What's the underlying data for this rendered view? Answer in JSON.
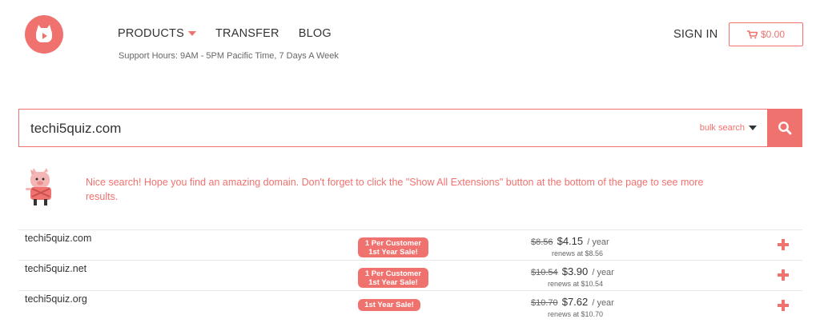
{
  "brand": {
    "logo_icon": "pig-logo-icon",
    "accent": "#f0726f"
  },
  "nav": {
    "products": "PRODUCTS",
    "transfer": "TRANSFER",
    "blog": "BLOG",
    "support": "Support Hours: 9AM - 5PM Pacific Time, 7 Days A Week"
  },
  "header": {
    "signin": "SIGN IN",
    "cart_total": "$0.00",
    "cart_icon": "cart-icon"
  },
  "search": {
    "value": "techi5quiz.com",
    "bulk_label": "bulk search",
    "button_icon": "search-icon"
  },
  "message": "Nice search! Hope you find an amazing domain. Don't forget to click the \"Show All Extensions\" button at the bottom of the page to see more results.",
  "results": [
    {
      "domain": "techi5quiz.com",
      "badge_line1": "1 Per Customer",
      "badge_line2": "1st Year Sale!",
      "old_price": "$8.56",
      "price": "$4.15",
      "per": "/ year",
      "renews": "renews at $8.56"
    },
    {
      "domain": "techi5quiz.net",
      "badge_line1": "1 Per Customer",
      "badge_line2": "1st Year Sale!",
      "old_price": "$10.54",
      "price": "$3.90",
      "per": "/ year",
      "renews": "renews at $10.54"
    },
    {
      "domain": "techi5quiz.org",
      "badge_line1": "1st Year Sale!",
      "badge_line2": "",
      "old_price": "$10.70",
      "price": "$7.62",
      "per": "/ year",
      "renews": "renews at $10.70"
    }
  ]
}
